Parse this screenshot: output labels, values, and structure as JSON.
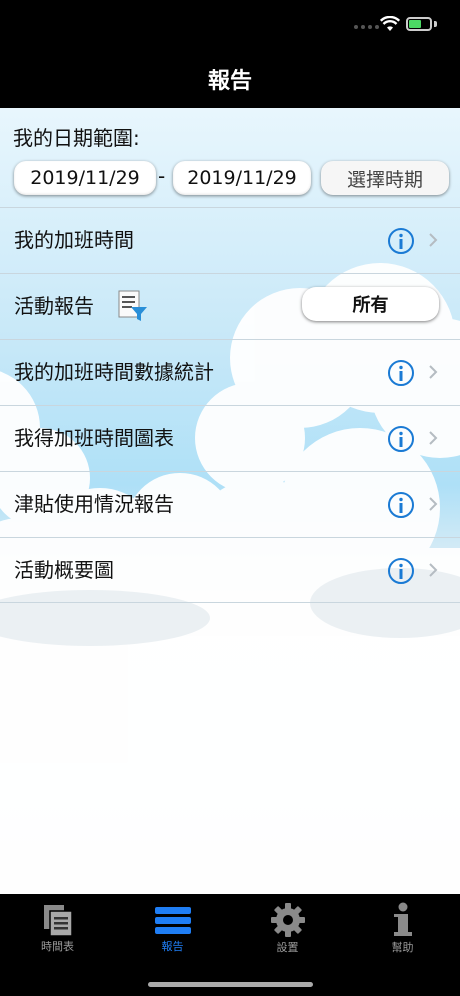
{
  "nav": {
    "title": "報告"
  },
  "date_range": {
    "label": "我的日期範圍:",
    "from": "2019/11/29",
    "separator": "-",
    "to": "2019/11/29",
    "select_period_label": "選擇時期"
  },
  "rows": [
    {
      "label": "我的加班時間",
      "icon": "info-icon"
    },
    {
      "label": "活動報告",
      "filter_label": "所有",
      "icon": "report-filter-icon"
    },
    {
      "label": "我的加班時間數據統計",
      "icon": "info-icon"
    },
    {
      "label": "我得加班時間圖表",
      "icon": "info-icon"
    },
    {
      "label": "津貼使用情況報告",
      "icon": "info-icon"
    },
    {
      "label": "活動概要圖",
      "icon": "info-icon"
    }
  ],
  "tabs": [
    {
      "label": "時間表",
      "icon": "timesheet-icon",
      "active": false
    },
    {
      "label": "報告",
      "icon": "report-icon",
      "active": true
    },
    {
      "label": "設置",
      "icon": "gear-icon",
      "active": false
    },
    {
      "label": "幫助",
      "icon": "info-i-icon",
      "active": false
    }
  ],
  "colors": {
    "accent": "#1f7ef5",
    "info": "#1a7ad4",
    "nav_bg": "#000000"
  }
}
